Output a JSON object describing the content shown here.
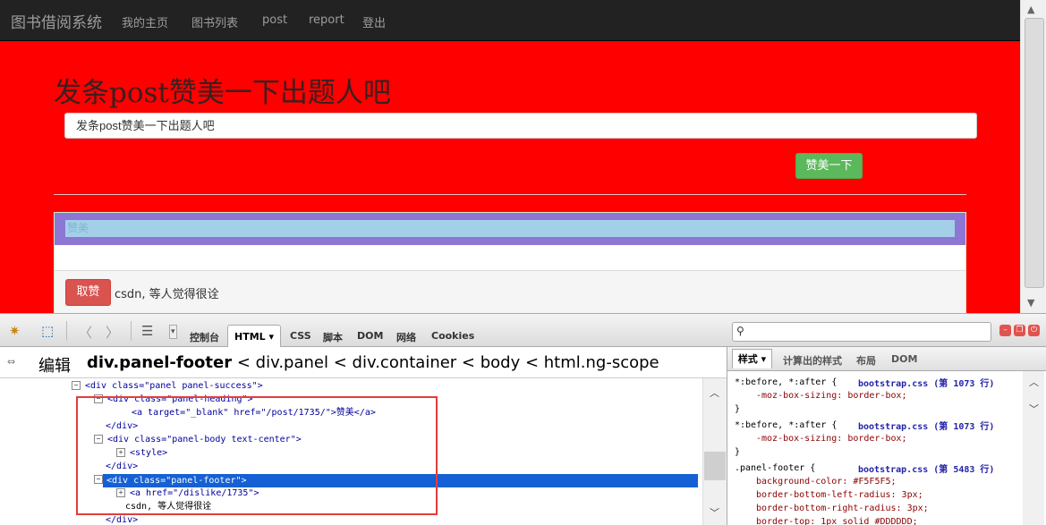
{
  "navbar": {
    "brand": "图书借阅系统",
    "links": [
      "我的主页",
      "图书列表",
      "post",
      "report",
      "登出"
    ]
  },
  "page": {
    "title": "发条post赞美一下出题人吧",
    "input_value": "发条post赞美一下出题人吧",
    "praise_button": "赞美一下",
    "panel": {
      "heading_link": "赞美",
      "dislike_button": "取赞",
      "footer_text": "csdn, 等人觉得很诠"
    }
  },
  "firebug": {
    "tabs": [
      "控制台",
      "HTML",
      "CSS",
      "脚本",
      "DOM",
      "网络",
      "Cookies"
    ],
    "active_tab": "HTML",
    "search_placeholder": "",
    "breadcrumb": {
      "edit_label": "编辑",
      "current": "div.panel-footer",
      "ancestors": "< div.panel < div.container < body < html.ng-scope"
    },
    "html_lines": {
      "l0": "<div class=\"panel panel-success\">",
      "l1": "<div class=\"panel-heading\">",
      "l2": "<a target=\"_blank\" href=\"/post/1735/\">赞美</a>",
      "l3": "</div>",
      "l4": "<div class=\"panel-body text-center\">",
      "l5": "<style>",
      "l6": "</div>",
      "l7": "<div class=\"panel-footer\">",
      "l8": "<a href=\"/dislike/1735\">",
      "l9": "csdn, 等人觉得很诠",
      "l10": "</div>"
    },
    "side_tabs": [
      "样式",
      "计算出的样式",
      "布局",
      "DOM"
    ],
    "css_rules": [
      {
        "selector": "*:before, *:after {",
        "source": "bootstrap.css (第 1073 行)",
        "decls": [
          "-moz-box-sizing: border-box;"
        ]
      },
      {
        "selector": "*:before, *:after {",
        "source": "bootstrap.css (第 1073 行)",
        "decls": [
          "-moz-box-sizing: border-box;"
        ]
      },
      {
        "selector": ".panel-footer {",
        "source": "bootstrap.css (第 5483 行)",
        "decls": [
          "background-color: #F5F5F5;",
          "border-bottom-left-radius: 3px;",
          "border-bottom-right-radius: 3px;",
          "border-top: 1px solid #DDDDDD;"
        ]
      }
    ],
    "close_brace": "}"
  },
  "colors": {
    "page_bg": "#fe0000",
    "navbar_bg": "#222222",
    "success_btn": "#5cb85c",
    "danger_btn": "#d9534f",
    "selection": "#1560d4",
    "annotation_box": "#e43c3c"
  }
}
